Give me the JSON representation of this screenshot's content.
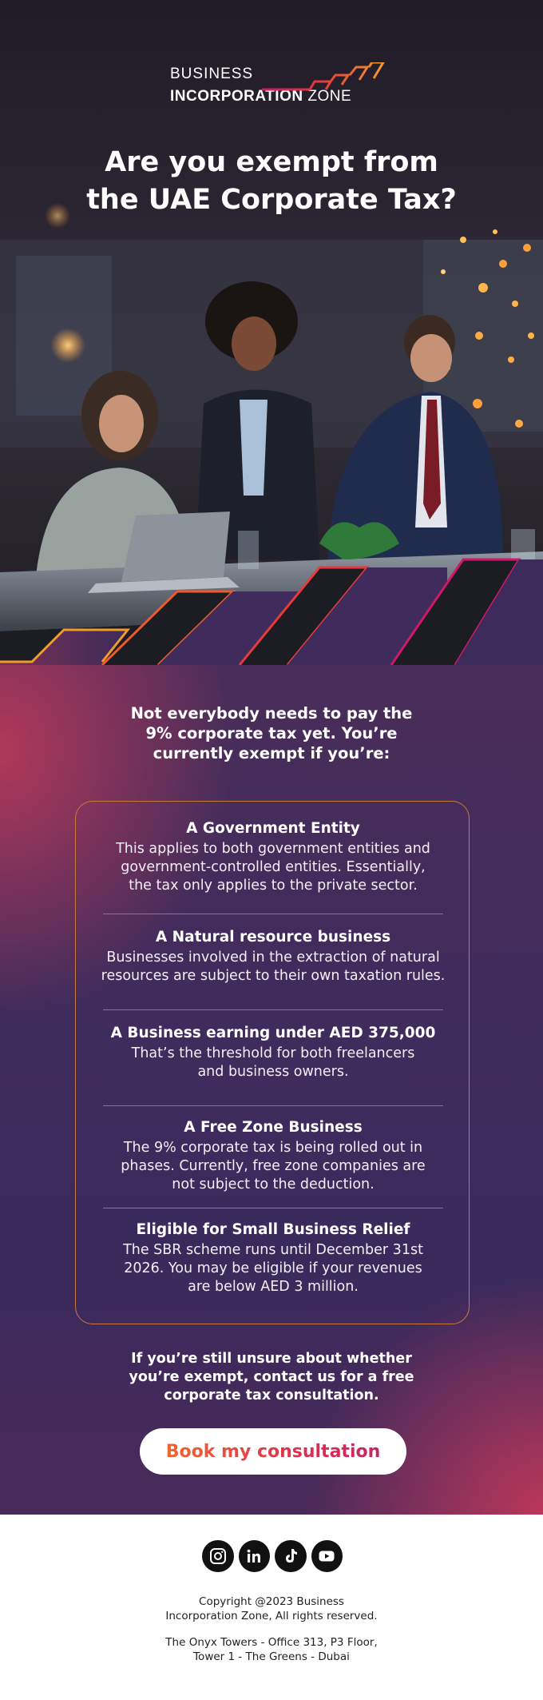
{
  "brand": {
    "line1": "BUSINESS",
    "line2_bold": "INCORPORATION",
    "line2_rest": "ZONE"
  },
  "hero": {
    "title_line1": "Are you exempt from",
    "title_line2": "the UAE Corporate Tax?"
  },
  "intro": {
    "line1": "Not everybody needs to pay the",
    "line2": "9% corporate tax yet. You’re",
    "line3": "currently exempt if you’re:"
  },
  "exemptions": [
    {
      "title": "A Government Entity",
      "body": [
        "This applies to both government entities and",
        "government-controlled entities. Essentially,",
        "the tax only applies to the private sector."
      ]
    },
    {
      "title": "A Natural resource business",
      "body": [
        "Businesses involved in the extraction of natural",
        "resources are subject to their own taxation rules."
      ]
    },
    {
      "title": "A Business earning under AED 375,000",
      "body": [
        "That’s the threshold for both freelancers",
        "and business owners."
      ]
    },
    {
      "title": "A Free Zone Business",
      "body": [
        "The 9% corporate tax is being rolled out in",
        "phases. Currently, free zone companies are",
        "not subject to the deduction."
      ]
    },
    {
      "title": "Eligible for Small Business Relief",
      "body": [
        "The SBR scheme runs until December 31st",
        "2026. You may be eligible if your revenues",
        "are below AED 3 million."
      ]
    }
  ],
  "outro": {
    "line1": "If you’re still unsure about whether",
    "line2": "you’re exempt, contact us for a free",
    "line3": "corporate tax consultation."
  },
  "cta": {
    "label": "Book my consultation"
  },
  "socials": [
    {
      "icon": "instagram-icon"
    },
    {
      "icon": "linkedin-icon"
    },
    {
      "icon": "tiktok-icon"
    },
    {
      "icon": "youtube-icon"
    }
  ],
  "footer": {
    "copyright_line1": "Copyright @2023 Business",
    "copyright_line2": "Incorporation Zone, All rights reserved.",
    "address_line1": "The Onyx Towers - Office 313, P3 Floor,",
    "address_line2": "Tower 1 - The Greens - Dubai"
  },
  "colors": {
    "accent_orange": "#f0662e",
    "accent_pink": "#e0304f",
    "purple": "#3f2c5c",
    "card_border": "#c77a3c"
  }
}
